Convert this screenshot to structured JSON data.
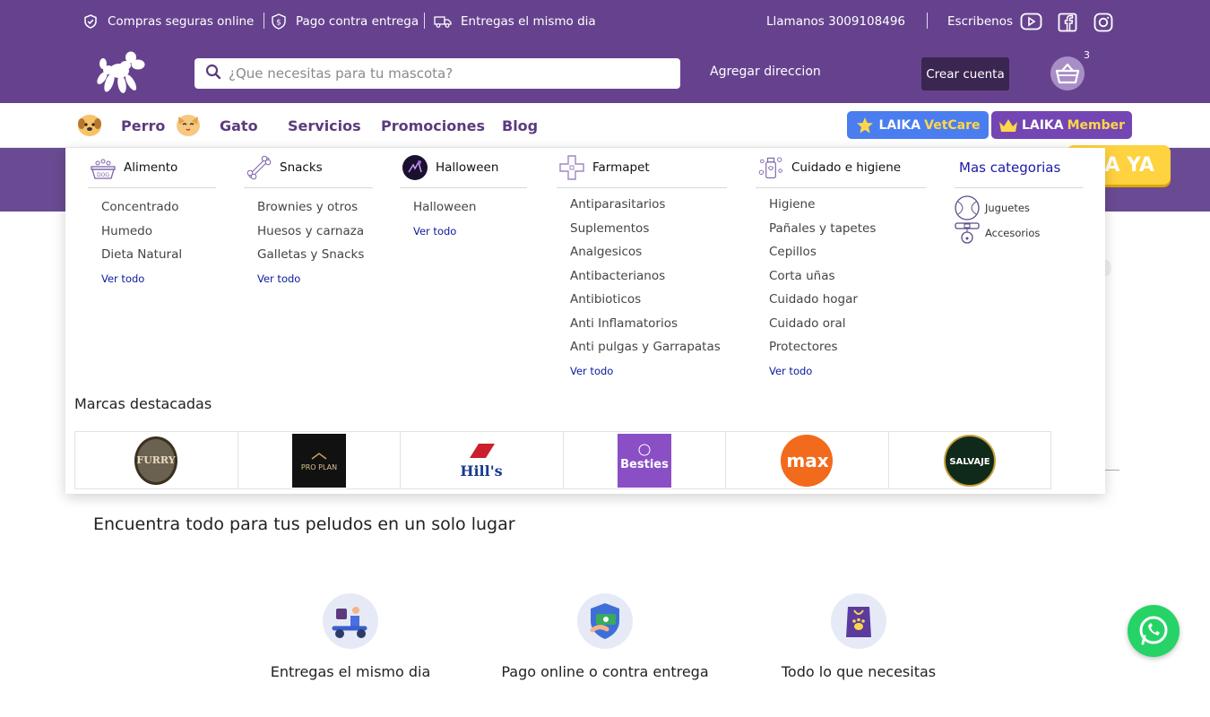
{
  "topbar": {
    "secure": "Compras seguras online",
    "cod": "Pago contra entrega",
    "sameday": "Entregas el mismo dia",
    "call": "Llamanos 3009108496",
    "write": "Escribenos"
  },
  "header": {
    "search_placeholder": "¿Que necesitas para tu mascota?",
    "address_link": "Agregar direccion",
    "create_account": "Crear cuenta",
    "cart_count": "3"
  },
  "nav": {
    "items": [
      "Perro",
      "Gato",
      "Servicios",
      "Promociones",
      "Blog"
    ],
    "vetcare": {
      "a": "LAIKA",
      "b": "VetCare"
    },
    "member": {
      "a": "LAIKA",
      "b": "Member"
    }
  },
  "hero": {
    "cta": "A YA"
  },
  "mega": {
    "columns": [
      {
        "title": "Alimento",
        "items": [
          "Concentrado",
          "Humedo",
          "Dieta Natural"
        ],
        "see_all": "Ver todo"
      },
      {
        "title": "Snacks",
        "items": [
          "Brownies y otros",
          "Huesos y carnaza",
          "Galletas y Snacks"
        ],
        "see_all": "Ver todo"
      },
      {
        "title": "Halloween",
        "items": [
          "Halloween"
        ],
        "see_all": "Ver todo"
      },
      {
        "title": "Farmapet",
        "items": [
          "Antiparasitarios",
          "Suplementos",
          "Analgesicos",
          "Antibacterianos",
          "Antibioticos",
          "Anti Inflamatorios",
          "Anti pulgas y Garrapatas"
        ],
        "see_all": "Ver todo"
      },
      {
        "title": "Cuidado e higiene",
        "items": [
          "Higiene",
          "Pañales y tapetes",
          "Cepillos",
          "Corta uñas",
          "Cuidado hogar",
          "Cuidado oral",
          "Protectores"
        ],
        "see_all": "Ver todo"
      }
    ],
    "more": {
      "title": "Mas categorias",
      "items": [
        "Juguetes",
        "Accesorios"
      ]
    },
    "brands_title": "Marcas destacadas",
    "brands": [
      "FURRY",
      "PRO PLAN",
      "Hill's",
      "Besties",
      "max",
      "SALVAJE"
    ]
  },
  "section": {
    "title": "Encuentra todo para tus peludos en un solo lugar",
    "features": [
      "Entregas el mismo dia",
      "Pago online o contra entrega",
      "Todo lo que necesitas"
    ]
  },
  "colors": {
    "brand_purple": "#66428e",
    "dark_purple": "#3b2652",
    "yellow": "#ffd23f",
    "whatsapp": "#25d366",
    "link_blue": "#0a1a9e"
  }
}
